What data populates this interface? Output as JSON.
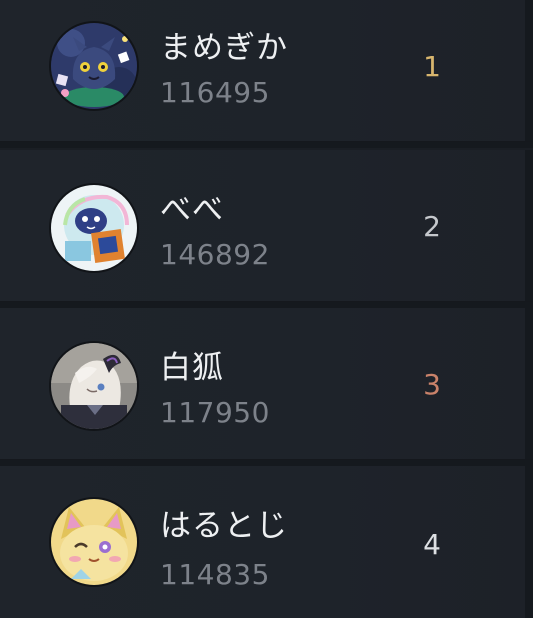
{
  "leaderboard": {
    "entries": [
      {
        "rank": "1",
        "name": "まめぎか",
        "score": "116495",
        "rank_color": "#d8b66e",
        "avatar": "navy-creature-avatar"
      },
      {
        "rank": "2",
        "name": "べべ",
        "score": "146892",
        "rank_color": "#c5c8cc",
        "avatar": "bubble-creature-avatar"
      },
      {
        "rank": "3",
        "name": "白狐",
        "score": "117950",
        "rank_color": "#c9826a",
        "avatar": "white-fox-avatar"
      },
      {
        "rank": "4",
        "name": "はるとじ",
        "score": "114835",
        "rank_color": "#dde0e3",
        "avatar": "yellow-cat-avatar"
      }
    ]
  },
  "theme": {
    "background": "#1a1e24",
    "row_background": "#1f242b",
    "name_color": "#eef0f2",
    "score_color": "#7d828a"
  }
}
